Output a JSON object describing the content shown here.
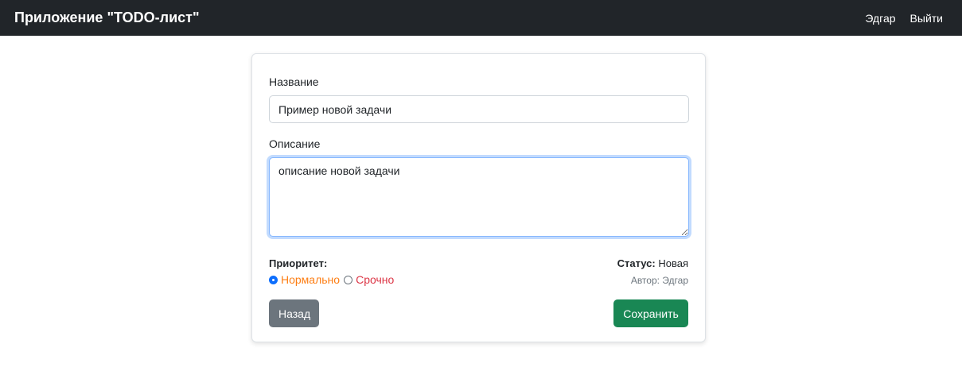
{
  "navbar": {
    "brand": "Приложение \"TODO-лист\"",
    "user_name": "Эдгар",
    "logout_label": "Выйти"
  },
  "form": {
    "title_label": "Название",
    "title_value": "Пример новой задачи",
    "description_label": "Описание",
    "description_value": "описание новой задачи",
    "priority_label": "Приоритет:",
    "priority_options": [
      {
        "label": "Нормально",
        "checked": true,
        "color": "#fd7e14"
      },
      {
        "label": "Срочно",
        "checked": false,
        "color": "#dc3545"
      }
    ],
    "status_key": "Статус:",
    "status_value": "Новая",
    "author_text": "Автор: Эдгар",
    "back_label": "Назад",
    "save_label": "Сохранить"
  },
  "colors": {
    "navbar_bg": "#212529",
    "back_button": "#6c757d",
    "save_button": "#198754",
    "focus_border": "#86b7fe"
  }
}
